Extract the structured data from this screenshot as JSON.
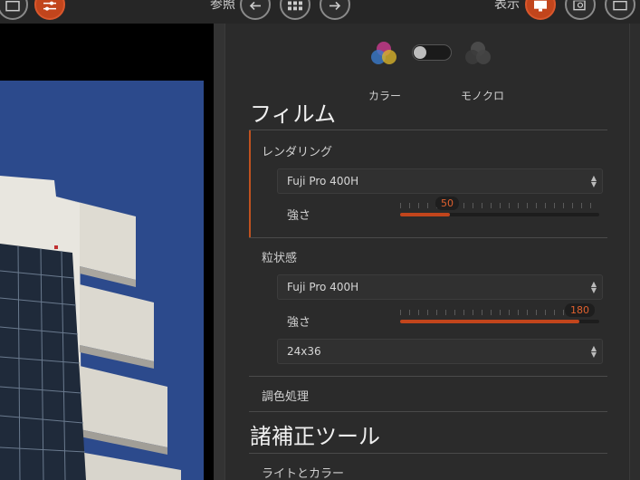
{
  "toolbar": {
    "reference_label": "参照",
    "display_label": "表示",
    "buttons": [
      {
        "name": "compare-icon"
      },
      {
        "name": "sliders-icon"
      },
      {
        "name": "arrow-left-icon"
      },
      {
        "name": "grid-icon"
      },
      {
        "name": "arrow-right-icon"
      },
      {
        "name": "monitor-icon"
      },
      {
        "name": "loupe-icon"
      },
      {
        "name": "fullscreen-icon"
      }
    ]
  },
  "mode": {
    "color_label": "カラー",
    "mono_label": "モノクロ",
    "selected": "カラー"
  },
  "film": {
    "title": "フィルム",
    "rendering": {
      "label": "レンダリング",
      "preset": "Fuji Pro 400H",
      "strength_label": "強さ",
      "strength_value": "50",
      "strength_fraction": 0.25
    },
    "grain": {
      "label": "粒状感",
      "preset": "Fuji Pro 400H",
      "strength_label": "強さ",
      "strength_value": "180",
      "strength_fraction": 0.9,
      "format": "24x36"
    },
    "toning_label": "調色処理"
  },
  "tools": {
    "title": "諸補正ツール",
    "light_color_label": "ライトとカラー"
  },
  "colors": {
    "accent": "#c2451c",
    "sky": "#2c4a8c",
    "building": "#e8e6df"
  }
}
